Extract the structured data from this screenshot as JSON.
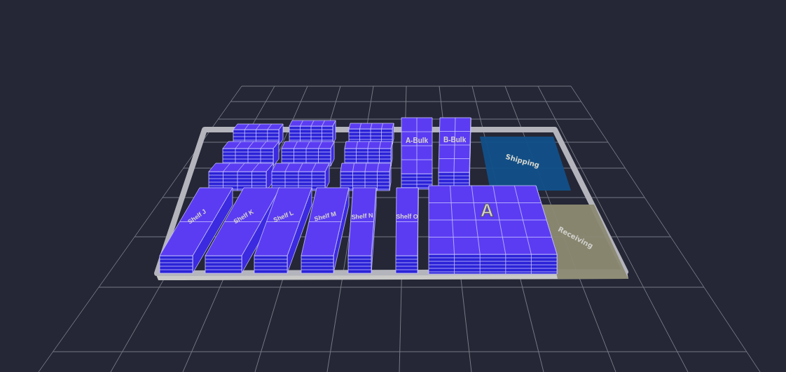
{
  "scene": {
    "zones": [
      {
        "label": "Shipping",
        "kind": "shipping"
      },
      {
        "label": "Receiving",
        "kind": "receiving"
      }
    ],
    "racks": [
      {
        "kind": "shelf"
      },
      {
        "kind": "shelf"
      },
      {
        "kind": "shelf"
      },
      {
        "kind": "shelf"
      },
      {
        "kind": "shelf"
      },
      {
        "kind": "shelf"
      },
      {
        "kind": "shelf"
      },
      {
        "kind": "shelf"
      },
      {
        "kind": "shelf"
      },
      {
        "kind": "bulk",
        "label": "A-Bulk"
      },
      {
        "kind": "bulk",
        "label": "B-Bulk"
      },
      {
        "kind": "long",
        "label": "Shelf J"
      },
      {
        "kind": "long",
        "label": "Shelf K"
      },
      {
        "kind": "long",
        "label": "Shelf L"
      },
      {
        "kind": "long",
        "label": "Shelf M"
      },
      {
        "kind": "long",
        "label": "Shelf N"
      },
      {
        "kind": "long",
        "label": "Shelf O"
      },
      {
        "kind": "block",
        "label": "A"
      }
    ]
  }
}
